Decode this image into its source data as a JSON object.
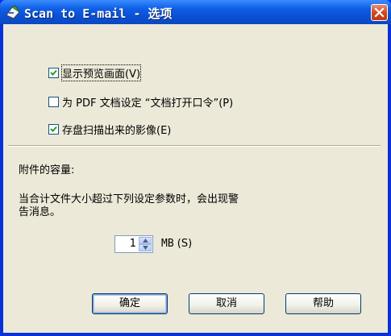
{
  "window": {
    "title": "Scan to E-mail - 选项",
    "colors": {
      "titlebar": "#0a4fd2",
      "client": "#ece9d8",
      "close": "#d1431b"
    },
    "icons": {
      "app": "scanner-app-icon",
      "close": "close-icon"
    }
  },
  "options": [
    {
      "label": "显示预览画面",
      "mnemonic": "(V)",
      "checked": true
    },
    {
      "label": "为 PDF 文档设定 “文档打开口令”",
      "mnemonic": "(P)",
      "checked": false
    },
    {
      "label": "存盘扫描出来的影像",
      "mnemonic": "(E)",
      "checked": true
    }
  ],
  "attachment": {
    "heading": "附件的容量:",
    "warning_line1": "当合计文件大小超过下列设定参数时，会出现警",
    "warning_line2": "告消息。",
    "size_value": "1",
    "unit_label": "MB",
    "unit_mnemonic": "(S)"
  },
  "buttons": {
    "ok": "确定",
    "cancel": "取消",
    "help": "帮助"
  }
}
